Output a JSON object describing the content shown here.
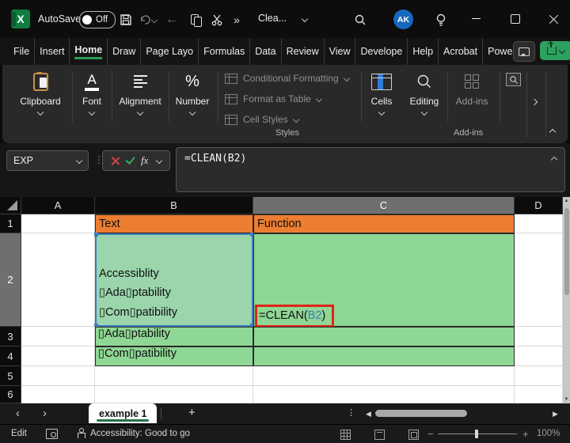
{
  "titlebar": {
    "autosave_label": "AutoSave",
    "autosave_state": "Off",
    "doc_title": "Clea...",
    "avatar_initials": "AK"
  },
  "glyphs": {
    "excel_x": "X",
    "more": "»",
    "back_arrow": "←",
    "font_a": "A",
    "percent": "%",
    "dots_vertical": "⋮",
    "tab_prev": "‹",
    "tab_next": "›",
    "scroll_left": "◀",
    "scroll_right": "▶",
    "scroll_up": "▲",
    "scroll_down": "▼",
    "zoom_out": "−",
    "zoom_in": "+"
  },
  "ribbon": {
    "active_tab": "Home",
    "tabs": [
      "File",
      "Insert",
      "Home",
      "Draw",
      "Page Layo",
      "Formulas",
      "Data",
      "Review",
      "View",
      "Develope",
      "Help",
      "Acrobat",
      "Power Piv"
    ],
    "groups": {
      "clipboard": "Clipboard",
      "font": "Font",
      "alignment": "Alignment",
      "number": "Number",
      "styles_items": [
        "Conditional Formatting",
        "Format as Table",
        "Cell Styles"
      ],
      "styles_label": "Styles",
      "cells": "Cells",
      "editing": "Editing",
      "addins_button": "Add-ins",
      "addins_label": "Add-ins"
    }
  },
  "formula_bar": {
    "name_box": "EXP",
    "fx_label": "fx",
    "formula_prefix": "=CLEAN(",
    "formula_ref": "B2",
    "formula_suffix": ")"
  },
  "grid": {
    "column_headers": [
      "A",
      "B",
      "C",
      "D"
    ],
    "row_headers": [
      "1",
      "2",
      "3",
      "4",
      "5",
      "6"
    ],
    "active_column": "C",
    "active_row": "2",
    "cells": {
      "b1": "Text",
      "c1": "Function",
      "b2_lines": [
        "Accessiblity",
        "▯Ada▯ptability",
        "▯Com▯patibility"
      ],
      "c2_prefix": "=CLEAN(",
      "c2_ref": "B2",
      "c2_suffix": ")",
      "b3": "▯Ada▯ptability",
      "b4": "▯Com▯patibility"
    }
  },
  "sheet_bar": {
    "tab": "example 1",
    "add_sheet": "+"
  },
  "status_bar": {
    "mode": "Edit",
    "accessibility": "Accessibility: Good to go",
    "zoom": "100%"
  },
  "colors": {
    "header_fill": "#ED7D31",
    "cell_fill_green": "#8FD794",
    "cell_fill_green_selected": "#9BD5AB",
    "ref_border_blue": "#3D7EBF",
    "annotation_red": "#E0241A",
    "accent_green": "#2F9E56",
    "share_green": "#2DA160",
    "avatar_blue": "#1668C0"
  }
}
